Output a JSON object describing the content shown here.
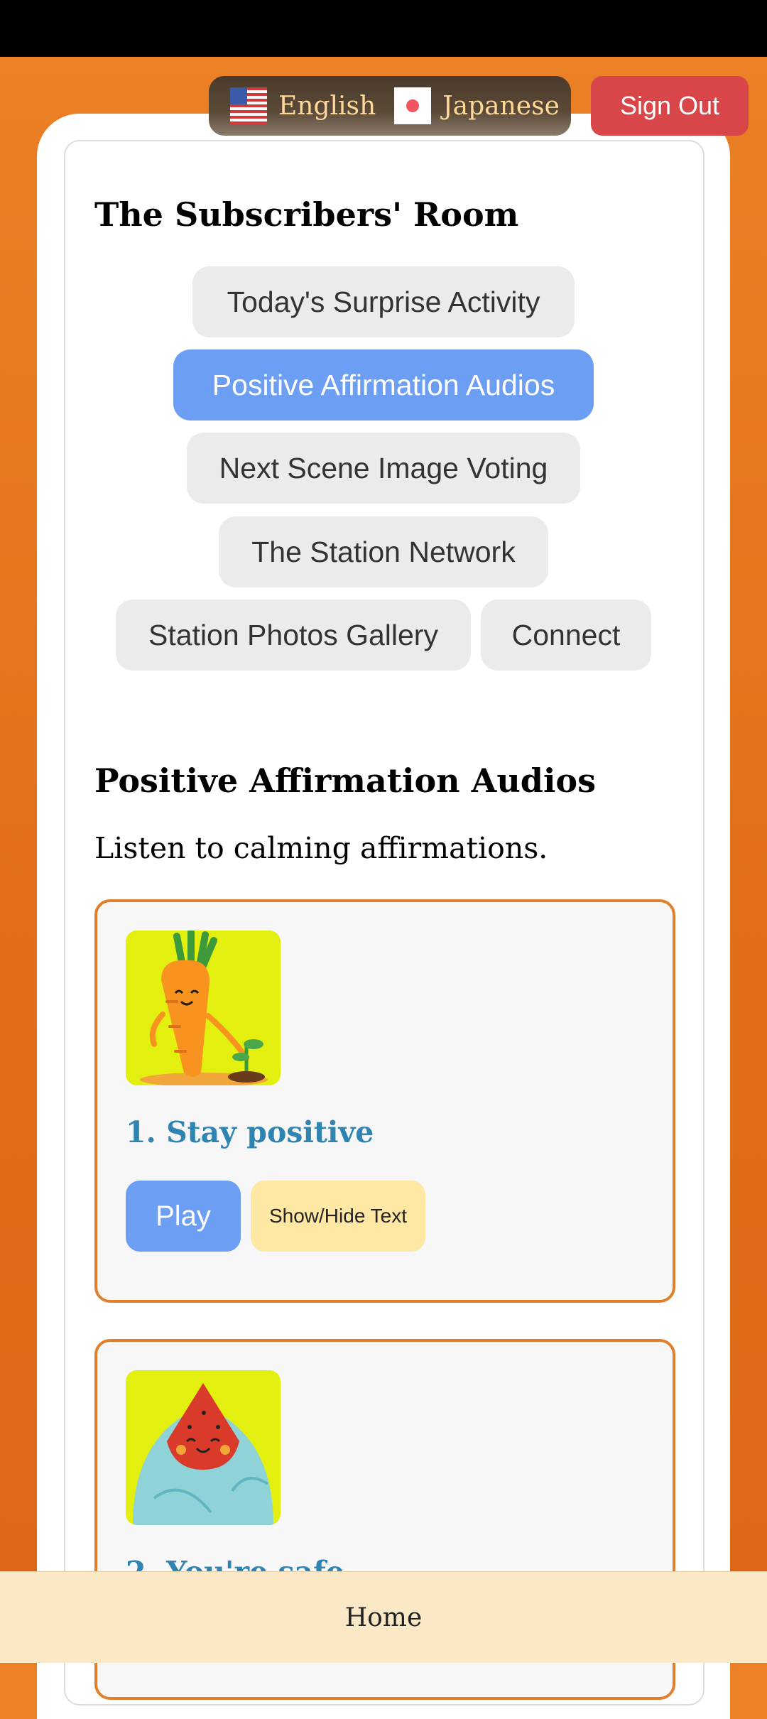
{
  "header": {
    "languages": [
      {
        "label": "English",
        "icon": "us-flag-icon"
      },
      {
        "label": "Japanese",
        "icon": "japan-flag-icon"
      }
    ],
    "sign_out_label": "Sign Out"
  },
  "room": {
    "title": "The Subscribers' Room",
    "nav": [
      {
        "label": "Today's Surprise Activity",
        "active": false
      },
      {
        "label": "Positive Affirmation Audios",
        "active": true
      },
      {
        "label": "Next Scene Image Voting",
        "active": false
      },
      {
        "label": "The Station Network",
        "active": false
      },
      {
        "label": "Station Photos Gallery",
        "active": false
      },
      {
        "label": "Connect",
        "active": false
      }
    ]
  },
  "section": {
    "title": "Positive Affirmation Audios",
    "subtitle": "Listen to calming affirmations."
  },
  "audios": [
    {
      "title": "1. Stay positive",
      "image": "carrot-character-icon",
      "play_label": "Play",
      "toggle_label": "Show/Hide Text"
    },
    {
      "title": "2. You're safe",
      "image": "watermelon-blanket-character-icon"
    }
  ],
  "bottom_nav": {
    "home_label": "Home"
  },
  "colors": {
    "background": "#e4731c",
    "accent_blue": "#6c9ff4",
    "sign_out_red": "#d9464a",
    "card_border": "#e07f2c",
    "title_blue": "#2f84b2",
    "toggle_yellow": "#ffe8a3",
    "bottom_bar": "#fbe8c6"
  }
}
